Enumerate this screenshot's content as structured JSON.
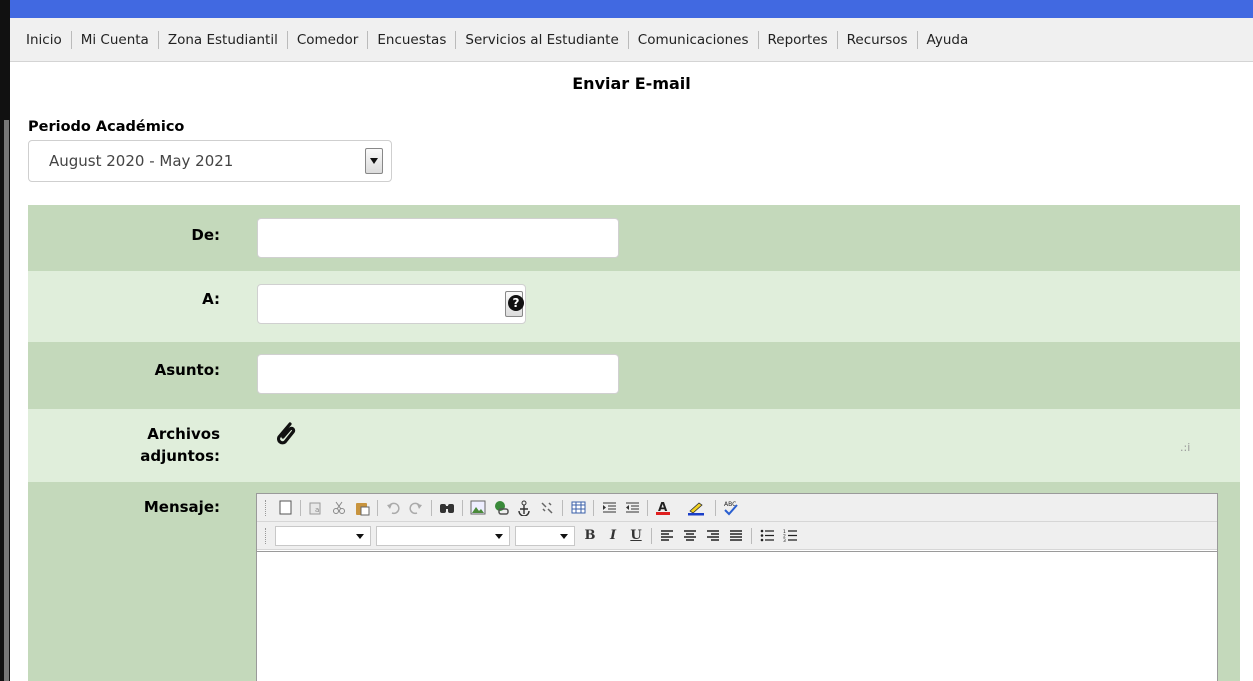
{
  "nav": {
    "items": [
      "Inicio",
      "Mi Cuenta",
      "Zona Estudiantil",
      "Comedor",
      "Encuestas",
      "Servicios al Estudiante",
      "Comunicaciones",
      "Reportes",
      "Recursos",
      "Ayuda"
    ]
  },
  "page": {
    "title": "Enviar E-mail"
  },
  "period": {
    "label": "Periodo Académico",
    "value": "August 2020 - May 2021"
  },
  "form": {
    "from_label": "De:",
    "from_value": "",
    "to_label": "A:",
    "to_value": "",
    "subject_label": "Asunto:",
    "subject_value": "",
    "attachments_label_line1": "Archivos",
    "attachments_label_line2": "adjuntos:",
    "message_label": "Mensaje:"
  },
  "colors": {
    "row_dark": "#c4d9bb",
    "row_light": "#e0eedb",
    "top_bar": "#4169e1"
  },
  "icons": {
    "help": "question-circle-icon",
    "attach": "paperclip-icon",
    "toolbar1": [
      "new-document-icon",
      "paste-text-icon",
      "cut-icon",
      "paste-icon",
      "undo-icon",
      "redo-icon",
      "find-icon",
      "image-icon",
      "link-icon",
      "anchor-icon",
      "unlink-icon",
      "table-icon",
      "outdent-icon",
      "indent-icon",
      "font-color-icon",
      "highlight-icon",
      "spellcheck-icon"
    ],
    "toolbar2": [
      "bold-icon",
      "italic-icon",
      "underline-icon",
      "align-left-icon",
      "align-center-icon",
      "align-right-icon",
      "justify-icon",
      "bullet-list-icon",
      "numbered-list-icon"
    ]
  },
  "editor": {
    "bold": "B",
    "italic": "I",
    "underline": "U"
  }
}
